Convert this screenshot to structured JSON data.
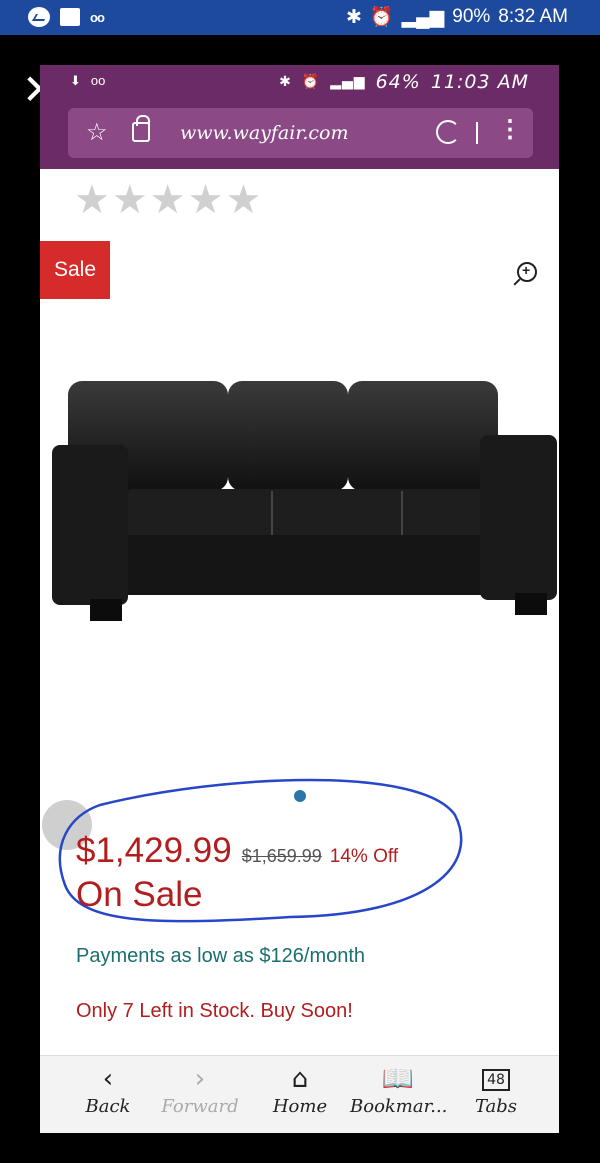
{
  "outer_status": {
    "battery": "90%",
    "time": "8:32 AM"
  },
  "inner_status": {
    "battery": "64%",
    "time": "11:03 AM"
  },
  "browser": {
    "url": "www.wayfair.com"
  },
  "product": {
    "badge": "Sale",
    "rating_stars": 5,
    "price": "$1,429.99",
    "original_price": "$1,659.99",
    "discount": "14% Off",
    "sale_label": "On Sale",
    "payments": "Payments as low as $126/month",
    "stock": "Only 7 Left in Stock. Buy Soon!"
  },
  "nav": {
    "back": "Back",
    "forward": "Forward",
    "home": "Home",
    "bookmarks": "Bookmar...",
    "tabs": "Tabs",
    "tab_count": "48"
  },
  "colors": {
    "accent": "#b21e1e",
    "browser_bar": "#6b2b66",
    "outer_bar": "#1d4a9c"
  }
}
